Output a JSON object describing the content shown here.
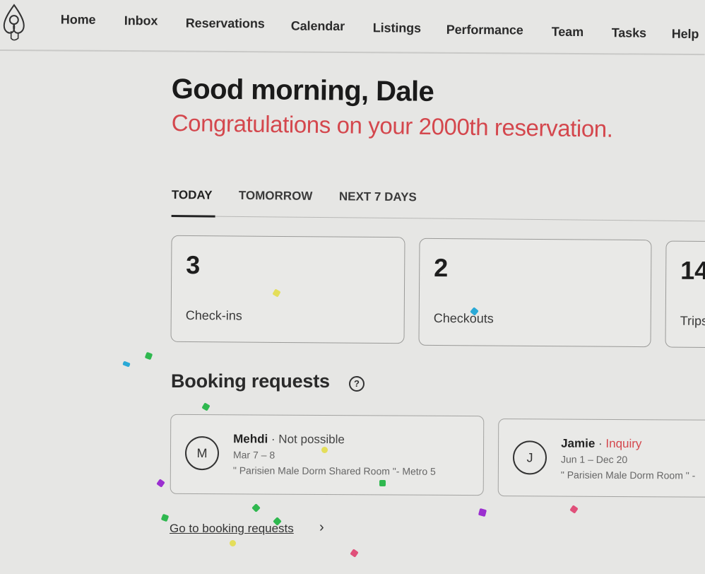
{
  "nav": {
    "logo": "airbnb-logo",
    "items": [
      {
        "label": "Home"
      },
      {
        "label": "Inbox"
      },
      {
        "label": "Reservations"
      },
      {
        "label": "Calendar"
      },
      {
        "label": "Listings"
      },
      {
        "label": "Performance"
      },
      {
        "label": "Team"
      },
      {
        "label": "Tasks"
      },
      {
        "label": "Help"
      }
    ]
  },
  "header": {
    "greeting": "Good morning, Dale",
    "congrats": "Congratulations on your 2000th reservation."
  },
  "tabs": [
    {
      "label": "TODAY",
      "active": true
    },
    {
      "label": "TOMORROW",
      "active": false
    },
    {
      "label": "NEXT 7 DAYS",
      "active": false
    }
  ],
  "stats": [
    {
      "value": "3",
      "label": "Check-ins"
    },
    {
      "value": "2",
      "label": "Checkouts"
    },
    {
      "value": "14",
      "label": "Trips"
    }
  ],
  "booking_requests": {
    "title": "Booking requests",
    "help_icon": "?",
    "requests": [
      {
        "initial": "M",
        "name": "Mehdi",
        "separator": " · ",
        "status": "Not possible",
        "status_color": "#444444",
        "dates": "Mar 7 – 8",
        "listing": "\" Parisien Male Dorm Shared Room \"- Metro 5"
      },
      {
        "initial": "J",
        "name": "Jamie",
        "separator": " · ",
        "status": "Inquiry",
        "status_color": "#d4474d",
        "dates": "Jun 1 – Dec 20",
        "listing": "\" Parisien Male Dorm Room \" -"
      }
    ],
    "link_label": "Go to booking requests",
    "link_chevron": "›"
  },
  "colors": {
    "accent": "#d4474d",
    "confetti": [
      "#e4de5a",
      "#2aa9d6",
      "#2fb84f",
      "#9b2fd0",
      "#e0507a"
    ]
  }
}
